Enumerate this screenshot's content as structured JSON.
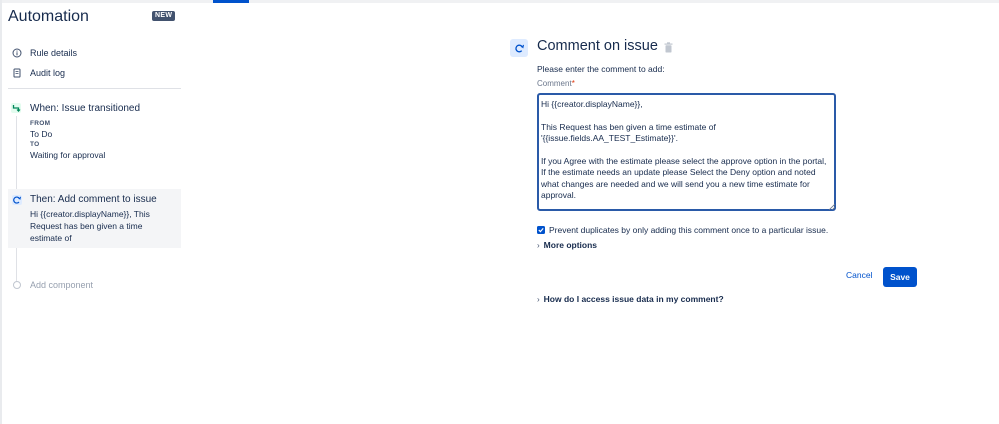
{
  "app": {
    "title": "Automation",
    "badge": "NEW"
  },
  "nav": {
    "items": [
      {
        "label": "Rule details",
        "icon": "info-icon"
      },
      {
        "label": "Audit log",
        "icon": "document-icon"
      }
    ]
  },
  "rule": {
    "trigger": {
      "title": "When: Issue transitioned",
      "from_label": "FROM",
      "from_value": "To Do",
      "to_label": "TO",
      "to_value": "Waiting for approval"
    },
    "action": {
      "title": "Then: Add comment to issue",
      "description": "Hi {{creator.displayName}}, This Request has ben given a time estimate of"
    },
    "add_component": "Add component"
  },
  "panel": {
    "title": "Comment on issue",
    "instruction": "Please enter the comment to add:",
    "field_label": "Comment",
    "required_marker": "*",
    "comment_value": "Hi {{creator.displayName}},\n\nThis Request has ben given a time estimate of\n'{{issue.fields.AA_TEST_Estimate}}'.\n\nIf you Agree with the estimate please select the approve option in the portal,  If the estimate needs an update please Select the Deny option and noted what changes are needed and we will send you a new time estimate for approval.",
    "prevent_duplicates_label": "Prevent duplicates by only adding this comment once to a particular issue.",
    "prevent_duplicates_checked": true,
    "more_options": "More options",
    "cancel_label": "Cancel",
    "save_label": "Save",
    "help_toggle": "How do I access issue data in my comment?"
  },
  "colors": {
    "primary": "#0052cc",
    "text": "#172b4d",
    "subtle": "#6b778c",
    "required": "#de350b",
    "selected_bg": "#f4f5f7"
  }
}
